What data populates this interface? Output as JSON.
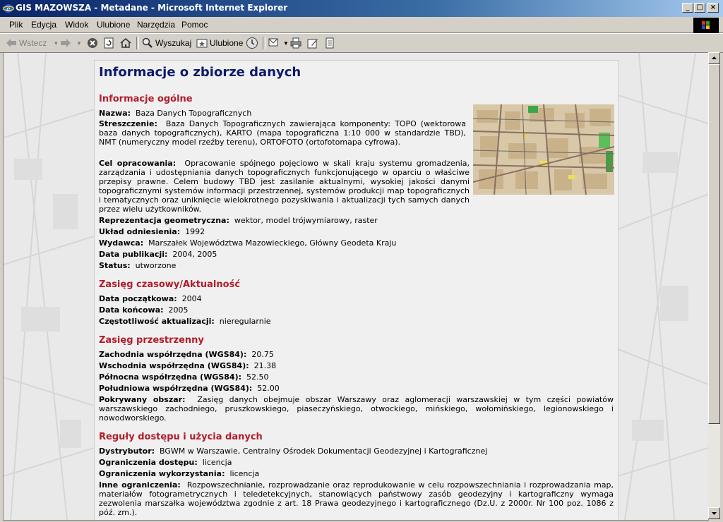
{
  "window": {
    "title": "GIS MAZOWSZA - Metadane - Microsoft Internet Explorer",
    "controls": [
      "_",
      "□",
      "×"
    ]
  },
  "menu": [
    "Plik",
    "Edycja",
    "Widok",
    "Ulubione",
    "Narzędzia",
    "Pomoc"
  ],
  "toolbar": {
    "back_label": "Wstecz",
    "search_label": "Wyszukaj",
    "favorites_label": "Ulubione"
  },
  "page": {
    "title": "Informacje o zbiorze danych",
    "general": {
      "heading": "Informacje ogólne",
      "nazwa_label": "Nazwa:",
      "nazwa": "Baza Danych Topograficznych",
      "streszczenie_label": "Streszczenie:",
      "streszczenie": "Baza Danych Topograficznych zawierająca komponenty: TOPO (wektorowa baza danych topograficznych), KARTO (mapa topograficzna 1:10 000 w standardzie TBD), NMT (numeryczny model rzeźby terenu), ORTOFOTO (ortofotomapa cyfrowa).",
      "cel_label": "Cel opracowania:",
      "cel": "Opracowanie spójnego pojęciowo w skali kraju systemu gromadzenia, zarządzania i udostępniania danych topograficznych funkcjonującego w oparciu o właściwe przepisy prawne. Celem budowy TBD jest zasilanie aktualnymi, wysokiej jakości danymi topograficznymi systemów informacji przestrzennej, systemów produkcji map topograficznych i tematycznych oraz uniknięcie wielokrotnego pozyskiwania i aktualizacji tych samych danych przez wielu użytkowników.",
      "reprezentacja_label": "Reprezentacja geometryczna:",
      "reprezentacja": "wektor, model trójwymiarowy, raster",
      "uklad_label": "Układ odniesienia:",
      "uklad": "1992",
      "wydawca_label": "Wydawca:",
      "wydawca": "Marszałek Województwa Mazowieckiego, Główny Geodeta Kraju",
      "data_label": "Data publikacji:",
      "data": "2004, 2005",
      "status_label": "Status:",
      "status": "utworzone"
    },
    "temporal": {
      "heading": "Zasięg czasowy/Aktualność",
      "start_label": "Data początkowa:",
      "start": "2004",
      "end_label": "Data końcowa:",
      "end": "2005",
      "freq_label": "Częstotliwość aktualizacji:",
      "freq": "nieregularnie"
    },
    "spatial": {
      "heading": "Zasięg przestrzenny",
      "west_label": "Zachodnia współrzędna (WGS84):",
      "west": "20.75",
      "east_label": "Wschodnia współrzędna (WGS84):",
      "east": "21.38",
      "north_label": "Północna współrzędna (WGS84):",
      "north": "52.50",
      "south_label": "Południowa współrzędna (WGS84):",
      "south": "52.00",
      "area_label": "Pokrywany obszar:",
      "area": "Zasięg danych obejmuje obszar Warszawy oraz aglomeracji warszawskiej w tym części powiatów warszawskiego zachodniego, pruszkowskiego, piaseczyńskiego, otwockiego, mińskiego, wołomińskiego, legionowskiego i nowodworskiego."
    },
    "access": {
      "heading": "Reguły dostępu i użycia danych",
      "dist_label": "Dystrybutor:",
      "dist": "BGWM w Warszawie, Centralny Ośrodek Dokumentacji Geodezyjnej i Kartograficznej",
      "access_label": "Ograniczenia dostępu:",
      "access_val": "licencja",
      "use_label": "Ograniczenia wykorzystania:",
      "use_val": "licencja",
      "other_label": "Inne ograniczenia:",
      "other": "Rozpowszechnianie, rozprowadzanie oraz reprodukowanie w celu rozpowszechniania i rozprowadzania map, materiałów fotogrametrycznych i teledetekcyjnych, stanowiących państwowy zasób geodezyjny i kartograficzny wymaga zezwolenia marszałka województwa zgodnie z art. 18 Prawa geodezyjnego i kartograficznego (Dz.U. z 2000r. Nr 100 poz. 1086 z póź. zm.)."
    }
  }
}
